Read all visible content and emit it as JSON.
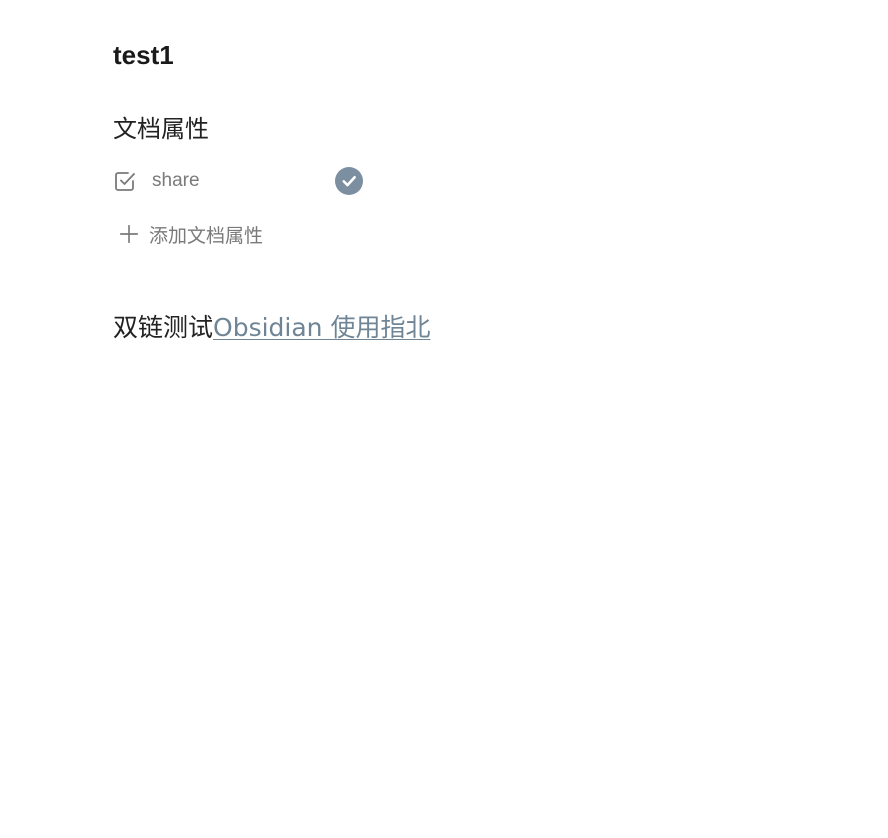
{
  "note": {
    "title": "test1",
    "properties": {
      "heading": "文档属性",
      "items": [
        {
          "key_icon": "checkbox-icon",
          "key": "share",
          "value_icon": "check-circle-icon",
          "value": true
        }
      ],
      "add_icon": "plus-icon",
      "add_label": "添加文档属性"
    },
    "body": {
      "text": "双链测试",
      "link_text": "Obsidian 使用指北"
    }
  },
  "colors": {
    "accent": "#7b8fa0",
    "link": "#6f8595",
    "muted_text": "#7a7a7a",
    "text": "#222222"
  }
}
